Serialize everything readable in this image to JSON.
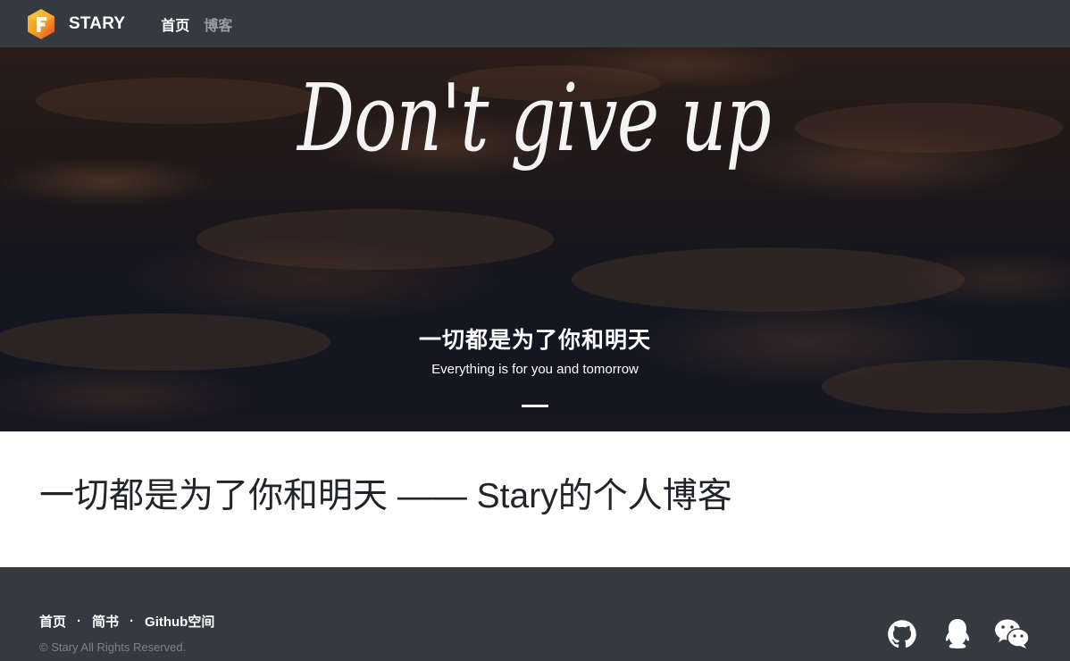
{
  "navbar": {
    "logo_icon": "f-hexagon-logo-icon",
    "brand": "STARY",
    "links": [
      {
        "label": "首页",
        "active": true
      },
      {
        "label": "博客",
        "active": false
      }
    ]
  },
  "hero": {
    "image_text": "Don't give up",
    "heading": "一切都是为了你和明天",
    "subheading": "Everything is for you and tomorrow"
  },
  "main": {
    "title": "一切都是为了你和明天 —— Stary的个人博客"
  },
  "footer": {
    "links": [
      "首页",
      "简书",
      "Github空间"
    ],
    "separator": "·",
    "copyright": "© Stary All Rights Reserved.",
    "social_icons": [
      "github-icon",
      "qq-icon",
      "wechat-icon"
    ]
  },
  "colors": {
    "navbar_bg": "#343a40",
    "footer_bg": "#343a40",
    "logo_orange": "#f7a928",
    "logo_red": "#e8432f",
    "text_dark": "#212529"
  }
}
